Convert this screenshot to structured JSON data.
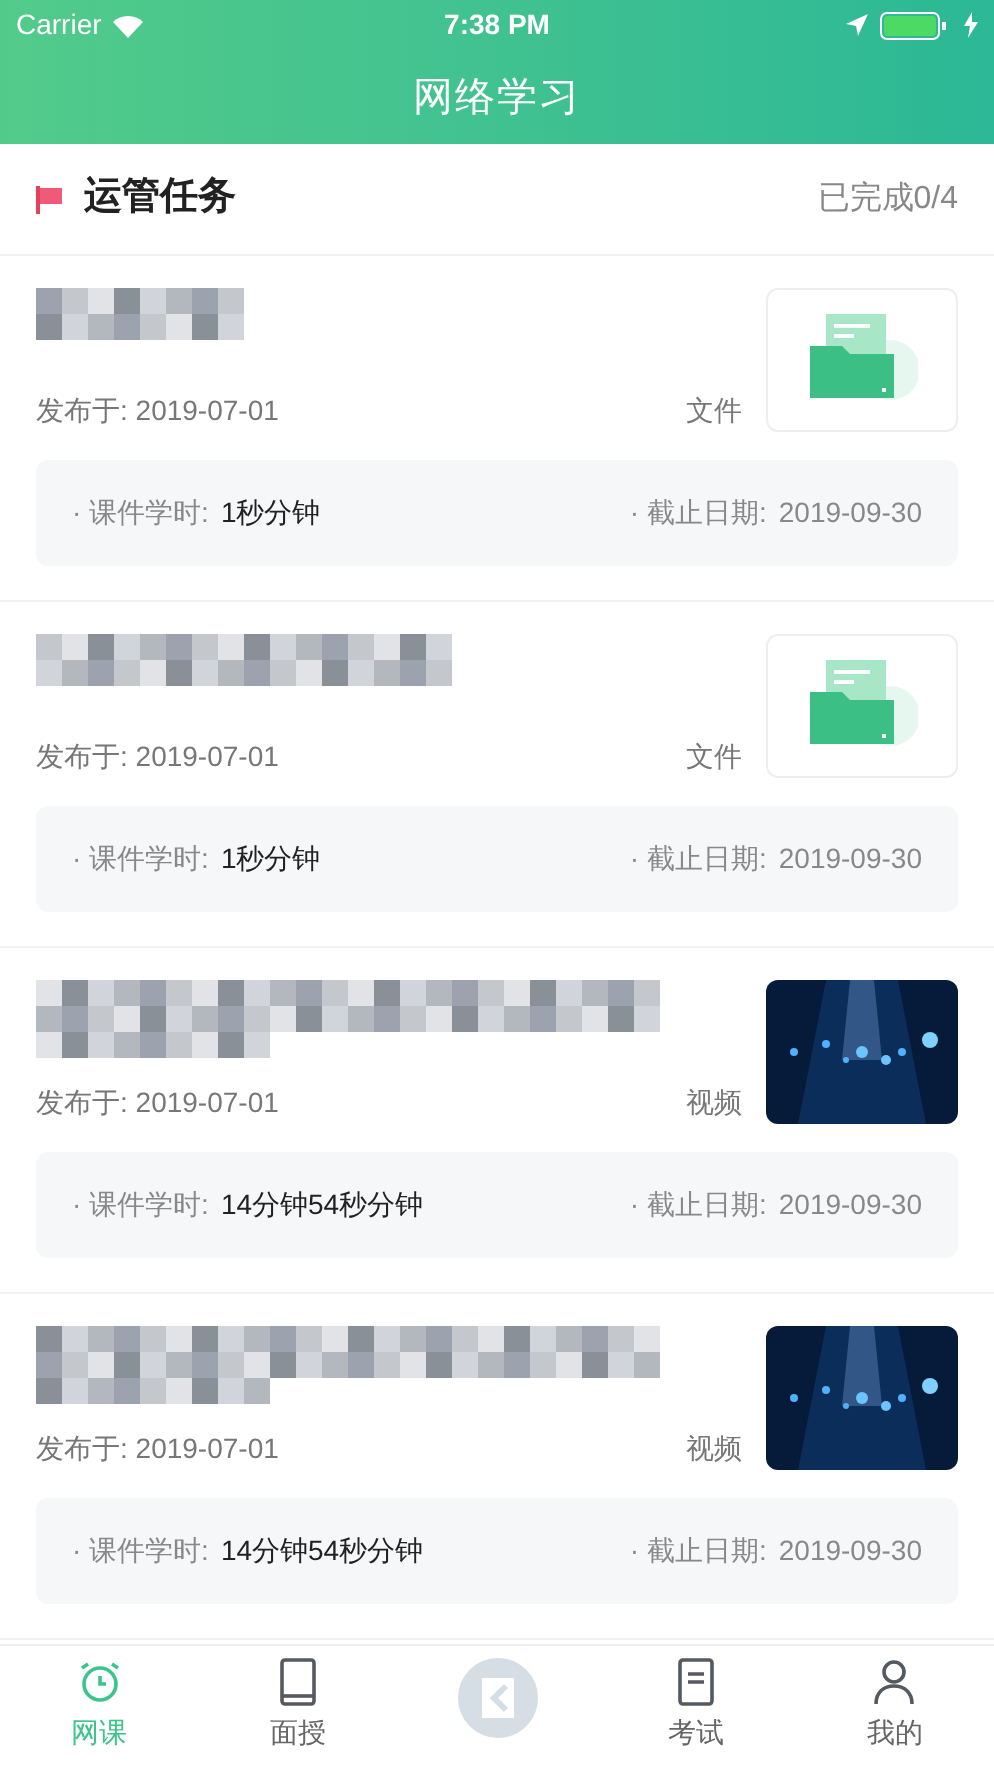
{
  "status_bar": {
    "carrier": "Carrier",
    "time": "7:38 PM"
  },
  "nav": {
    "title": "网络学习"
  },
  "section": {
    "title": "运管任务",
    "progress": "已完成0/4"
  },
  "tasks": [
    {
      "kind": "file",
      "published": "发布于: 2019-07-01",
      "type": "文件",
      "hours_label": "· 课件学时:",
      "hours": "1秒分钟",
      "deadline_label": "· 截止日期:",
      "deadline": "2019-09-30"
    },
    {
      "kind": "file",
      "published": "发布于: 2019-07-01",
      "type": "文件",
      "hours_label": "· 课件学时:",
      "hours": "1秒分钟",
      "deadline_label": "· 截止日期:",
      "deadline": "2019-09-30"
    },
    {
      "kind": "video",
      "published": "发布于: 2019-07-01",
      "type": "视频",
      "hours_label": "· 课件学时:",
      "hours": "14分钟54秒分钟",
      "deadline_label": "· 截止日期:",
      "deadline": "2019-09-30"
    },
    {
      "kind": "video",
      "published": "发布于: 2019-07-01",
      "type": "视频",
      "hours_label": "· 课件学时:",
      "hours": "14分钟54秒分钟",
      "deadline_label": "· 截止日期:",
      "deadline": "2019-09-30"
    }
  ],
  "tab_bar": [
    {
      "kind": "clock",
      "label": "网课",
      "selected": true
    },
    {
      "kind": "tablet",
      "label": "面授",
      "selected": false
    },
    {
      "kind": "center"
    },
    {
      "kind": "doc",
      "label": "考试",
      "selected": false
    },
    {
      "kind": "person",
      "label": "我的",
      "selected": false
    }
  ]
}
